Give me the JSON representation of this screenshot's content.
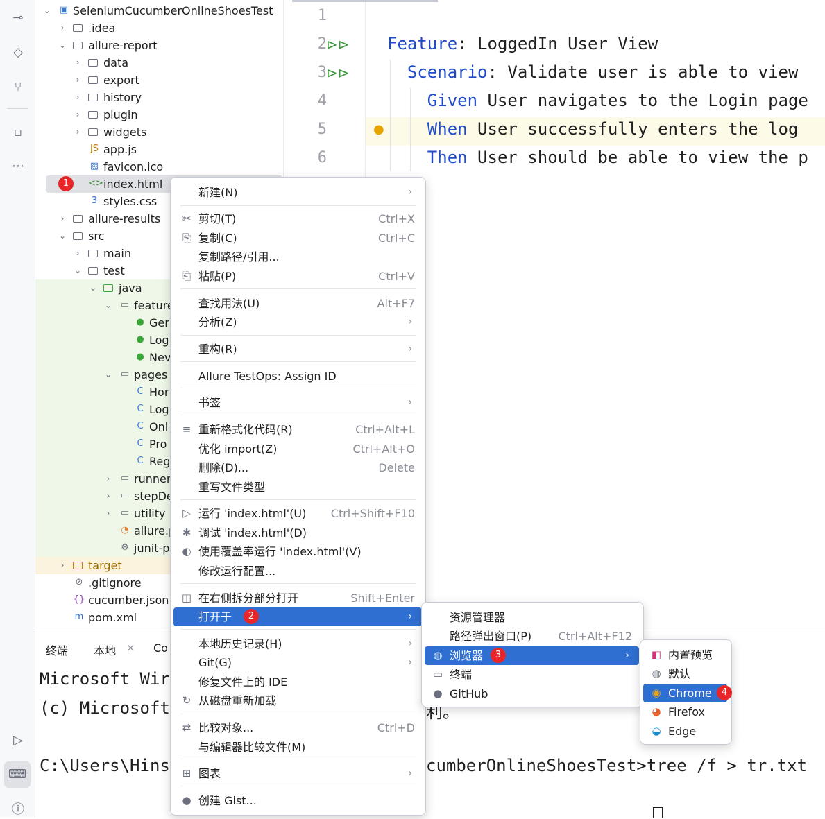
{
  "project_tree": {
    "rows": [
      {
        "label": "SeleniumCucumberOnlineShoesTest",
        "icon": "module-icon"
      },
      {
        "label": ".idea",
        "icon": "folder-icon"
      },
      {
        "label": "allure-report",
        "icon": "folder-icon"
      },
      {
        "label": "data",
        "icon": "folder-icon"
      },
      {
        "label": "export",
        "icon": "folder-icon"
      },
      {
        "label": "history",
        "icon": "folder-icon"
      },
      {
        "label": "plugin",
        "icon": "folder-icon"
      },
      {
        "label": "widgets",
        "icon": "folder-icon"
      },
      {
        "label": "app.js",
        "icon": "js-file-icon"
      },
      {
        "label": "favicon.ico",
        "icon": "image-file-icon"
      },
      {
        "label": "index.html",
        "icon": "html-file-icon"
      },
      {
        "label": "styles.css",
        "icon": "css-file-icon"
      },
      {
        "label": "allure-results",
        "icon": "folder-icon"
      },
      {
        "label": "src",
        "icon": "folder-icon"
      },
      {
        "label": "main",
        "icon": "folder-icon"
      },
      {
        "label": "test",
        "icon": "folder-icon"
      },
      {
        "label": "java",
        "icon": "folder-icon"
      },
      {
        "label": "feature",
        "icon": "package-icon"
      },
      {
        "label": "Ger",
        "icon": "cucumber-icon"
      },
      {
        "label": "Log",
        "icon": "cucumber-icon"
      },
      {
        "label": "Nev",
        "icon": "cucumber-icon"
      },
      {
        "label": "pages",
        "icon": "package-icon"
      },
      {
        "label": "Hor",
        "icon": "class-icon"
      },
      {
        "label": "Log",
        "icon": "class-icon"
      },
      {
        "label": "Onl",
        "icon": "class-icon"
      },
      {
        "label": "Pro",
        "icon": "class-icon"
      },
      {
        "label": "Reg",
        "icon": "class-icon"
      },
      {
        "label": "runner",
        "icon": "package-icon"
      },
      {
        "label": "stepDe",
        "icon": "package-icon"
      },
      {
        "label": "utility",
        "icon": "package-icon"
      },
      {
        "label": "allure.p",
        "icon": "allure-icon"
      },
      {
        "label": "junit-p",
        "icon": "settings-file-icon"
      },
      {
        "label": "target",
        "icon": "folder-icon"
      },
      {
        "label": ".gitignore",
        "icon": "gitignore-icon"
      },
      {
        "label": "cucumber.json",
        "icon": "json-file-icon"
      },
      {
        "label": "pom.xml",
        "icon": "maven-icon"
      }
    ]
  },
  "editor": {
    "lines": [
      {
        "num": "1",
        "keyword": "",
        "text": ""
      },
      {
        "num": "2",
        "keyword": "Feature",
        "text": ": LoggedIn User View"
      },
      {
        "num": "3",
        "keyword": "Scenario",
        "text": ": Validate user is able to view"
      },
      {
        "num": "4",
        "keyword": "Given",
        "text": " User navigates to the Login page"
      },
      {
        "num": "5",
        "keyword": "When",
        "text": " User successfully enters the log"
      },
      {
        "num": "6",
        "keyword": "Then",
        "text": " User should be able to view the p"
      }
    ]
  },
  "terminal": {
    "tabs": [
      "终端",
      "本地",
      "Co"
    ],
    "lines": [
      "Microsoft Wir",
      "(c) Microsoft",
      "",
      "C:\\Users\\Hins",
      ""
    ],
    "right_fragments": {
      "line2": "利。",
      "line4": "cumberOnlineShoesTest>tree /f > tr.txt"
    }
  },
  "context_menu": {
    "items": [
      {
        "label": "新建(N)",
        "shortcut": "",
        "submenu": true
      },
      {
        "label": "剪切(T)",
        "shortcut": "Ctrl+X",
        "submenu": false
      },
      {
        "label": "复制(C)",
        "shortcut": "Ctrl+C",
        "submenu": false
      },
      {
        "label": "复制路径/引用...",
        "shortcut": "",
        "submenu": false
      },
      {
        "label": "粘贴(P)",
        "shortcut": "Ctrl+V",
        "submenu": false
      },
      {
        "label": "查找用法(U)",
        "shortcut": "Alt+F7",
        "submenu": false
      },
      {
        "label": "分析(Z)",
        "shortcut": "",
        "submenu": true
      },
      {
        "label": "重构(R)",
        "shortcut": "",
        "submenu": true
      },
      {
        "label": "Allure TestOps: Assign ID",
        "shortcut": "",
        "submenu": false
      },
      {
        "label": "书签",
        "shortcut": "",
        "submenu": true
      },
      {
        "label": "重新格式化代码(R)",
        "shortcut": "Ctrl+Alt+L",
        "submenu": false
      },
      {
        "label": "优化 import(Z)",
        "shortcut": "Ctrl+Alt+O",
        "submenu": false
      },
      {
        "label": "删除(D)...",
        "shortcut": "Delete",
        "submenu": false
      },
      {
        "label": "重写文件类型",
        "shortcut": "",
        "submenu": false
      },
      {
        "label": "运行 'index.html'(U)",
        "shortcut": "Ctrl+Shift+F10",
        "submenu": false
      },
      {
        "label": "调试 'index.html'(D)",
        "shortcut": "",
        "submenu": false
      },
      {
        "label": "使用覆盖率运行 'index.html'(V)",
        "shortcut": "",
        "submenu": false
      },
      {
        "label": "修改运行配置...",
        "shortcut": "",
        "submenu": false
      },
      {
        "label": "在右侧拆分部分打开",
        "shortcut": "Shift+Enter",
        "submenu": false
      },
      {
        "label": "打开于",
        "shortcut": "",
        "submenu": true
      },
      {
        "label": "本地历史记录(H)",
        "shortcut": "",
        "submenu": true
      },
      {
        "label": "Git(G)",
        "shortcut": "",
        "submenu": true
      },
      {
        "label": "修复文件上的 IDE",
        "shortcut": "",
        "submenu": false
      },
      {
        "label": "从磁盘重新加载",
        "shortcut": "",
        "submenu": false
      },
      {
        "label": "比较对象...",
        "shortcut": "Ctrl+D",
        "submenu": false
      },
      {
        "label": "与编辑器比较文件(M)",
        "shortcut": "",
        "submenu": false
      },
      {
        "label": "图表",
        "shortcut": "",
        "submenu": true
      },
      {
        "label": "创建 Gist...",
        "shortcut": "",
        "submenu": false
      }
    ]
  },
  "open_in_menu": {
    "items": [
      {
        "label": "资源管理器",
        "shortcut": ""
      },
      {
        "label": "路径弹出窗口(P)",
        "shortcut": "Ctrl+Alt+F12"
      },
      {
        "label": "浏览器",
        "shortcut": ""
      },
      {
        "label": "终端",
        "shortcut": ""
      },
      {
        "label": "GitHub",
        "shortcut": ""
      }
    ]
  },
  "browser_menu": {
    "items": [
      {
        "label": "内置预览",
        "icon": "intellij-icon"
      },
      {
        "label": "默认",
        "icon": "globe-icon"
      },
      {
        "label": "Chrome",
        "icon": "chrome-icon"
      },
      {
        "label": "Firefox",
        "icon": "firefox-icon"
      },
      {
        "label": "Edge",
        "icon": "edge-icon"
      }
    ]
  },
  "step_badges": [
    "1",
    "2",
    "3",
    "4"
  ],
  "colors": {
    "accent": "#2f6fd2",
    "badge": "#e8262a",
    "keyword": "#1f4bc9",
    "selection": "#dfe1e5"
  }
}
